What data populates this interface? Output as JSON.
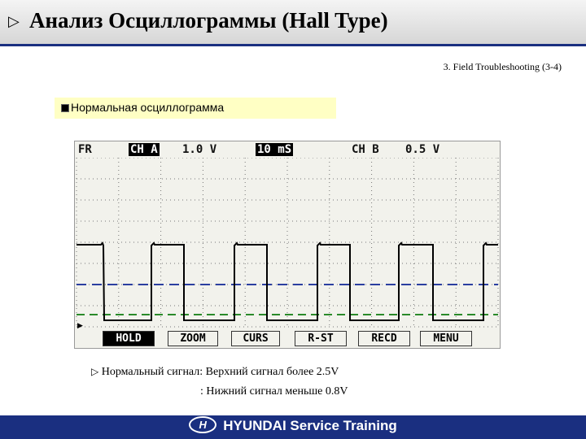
{
  "header": {
    "marker": "▷",
    "title": "Анализ Осциллограммы (Hall Type)"
  },
  "section_label": "3. Field Troubleshooting (3-4)",
  "subtitle": "Нормальная осциллограмма",
  "scope": {
    "top_bar": {
      "mode": "FR",
      "channel_a": "CH A",
      "voltage_a": "1.0 V",
      "timebase": "10 mS",
      "channel_b": "CH B",
      "voltage_b": "0.5 V"
    },
    "menu": [
      "HOLD",
      "ZOOM",
      "CURS",
      "R-ST",
      "RECD",
      "MENU"
    ],
    "active_menu": "HOLD",
    "colors": {
      "signal": "#000000",
      "ref_line_blue": "#2b3fa0",
      "ref_line_green": "#2a8a2a",
      "grid": "#777777",
      "screen": "#f2f2ec"
    }
  },
  "notes": {
    "marker": "▷",
    "line1": "Нормальный сигнал: Верхний сигнал более 2.5V",
    "line2": ": Нижний сигнал меньше 0.8V"
  },
  "footer": {
    "logo_mark": "H",
    "brand": "HYUNDAI Service Training"
  }
}
